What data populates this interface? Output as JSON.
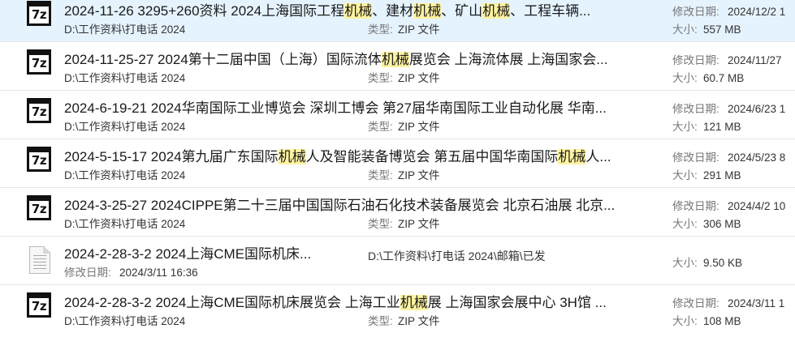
{
  "labels": {
    "modified": "修改日期:",
    "type": "类型:",
    "size": "大小:"
  },
  "results": [
    {
      "icon": "7z-archive-icon",
      "title_parts": [
        {
          "text": "2024-11-26 3295+260资料  2024上海国际工程",
          "hl": false
        },
        {
          "text": "机械",
          "hl": true
        },
        {
          "text": "、建材",
          "hl": false
        },
        {
          "text": "机械",
          "hl": true
        },
        {
          "text": "、矿山",
          "hl": false
        },
        {
          "text": "机械",
          "hl": true
        },
        {
          "text": "、工程车辆...",
          "hl": false
        }
      ],
      "path": "D:\\工作资料\\打电话 2024",
      "type": "ZIP 文件",
      "modified": "2024/12/2 1",
      "size": "557 MB"
    },
    {
      "icon": "7z-archive-icon",
      "title_parts": [
        {
          "text": "2024-11-25-27 2024第十二届中国（上海）国际流体",
          "hl": false
        },
        {
          "text": "机械",
          "hl": true
        },
        {
          "text": "展览会 上海流体展 上海国家会...",
          "hl": false
        }
      ],
      "path": "D:\\工作资料\\打电话 2024",
      "type": "ZIP 文件",
      "modified": "2024/11/27",
      "size": "60.7 MB"
    },
    {
      "icon": "7z-archive-icon",
      "title_parts": [
        {
          "text": "2024-6-19-21 2024华南国际工业博览会 深圳工博会  第27届华南国际工业自动化展 华南...",
          "hl": false
        }
      ],
      "path": "D:\\工作资料\\打电话 2024",
      "type": "ZIP 文件",
      "modified": "2024/6/23 1",
      "size": "121 MB"
    },
    {
      "icon": "7z-archive-icon",
      "title_parts": [
        {
          "text": "2024-5-15-17 2024第九届广东国际",
          "hl": false
        },
        {
          "text": "机械",
          "hl": true
        },
        {
          "text": "人及智能装备博览会 第五届中国华南国际",
          "hl": false
        },
        {
          "text": "机械",
          "hl": true
        },
        {
          "text": "人...",
          "hl": false
        }
      ],
      "path": "D:\\工作资料\\打电话 2024",
      "type": "ZIP 文件",
      "modified": "2024/5/23 8",
      "size": "291 MB"
    },
    {
      "icon": "7z-archive-icon",
      "title_parts": [
        {
          "text": "2024-3-25-27 2024CIPPE第二十三届中国国际石油石化技术装备展览会 北京石油展 北京...",
          "hl": false
        }
      ],
      "path": "D:\\工作资料\\打电话 2024",
      "type": "ZIP 文件",
      "modified": "2024/4/2 10",
      "size": "306 MB"
    },
    {
      "icon": "document-icon",
      "title_parts": [
        {
          "text": "2024-2-28-3-2 2024上海CME国际机床...",
          "hl": false
        }
      ],
      "path": "D:\\工作资料\\打电话 2024\\邮箱\\已发",
      "modified": "2024/3/11 16:36",
      "size": "9.50 KB"
    },
    {
      "icon": "7z-archive-icon",
      "title_parts": [
        {
          "text": "2024-2-28-3-2 2024上海CME国际机床展览会 上海工业",
          "hl": false
        },
        {
          "text": "机械",
          "hl": true
        },
        {
          "text": "展 上海国家会展中心 3H馆 ...",
          "hl": false
        }
      ],
      "path": "D:\\工作资料\\打电话 2024",
      "type": "ZIP 文件",
      "modified": "2024/3/11 1",
      "size": "108 MB"
    }
  ]
}
